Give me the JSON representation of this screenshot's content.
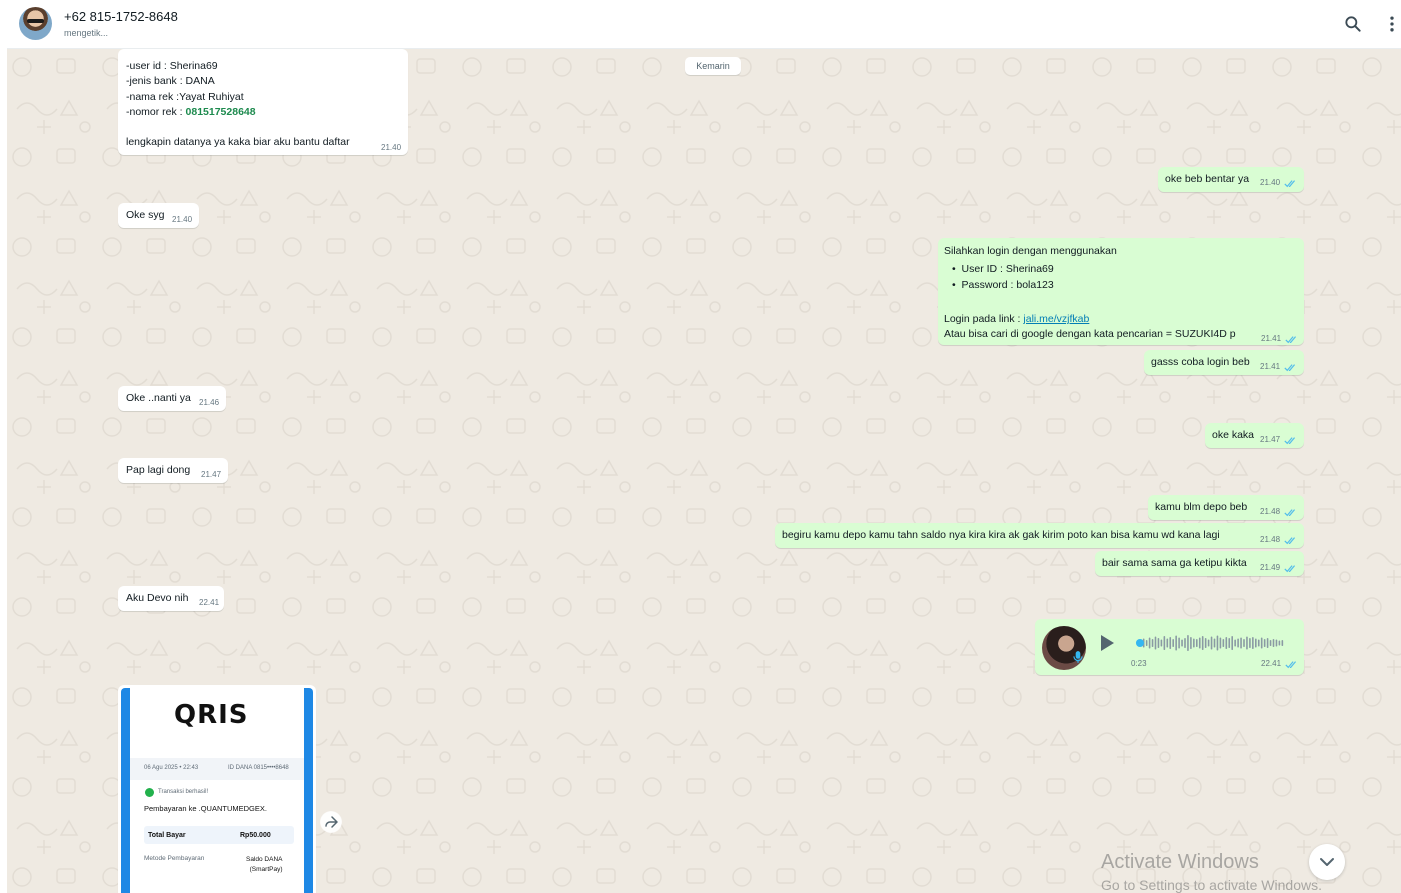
{
  "header": {
    "contact_name": "+62 815-1752-8648",
    "contact_status": "mengetik..."
  },
  "day_chip": "Kemarin",
  "messages": {
    "m1": {
      "lines": [
        "-user id : Sherina69",
        "-jenis bank : DANA",
        "-nama rek :Yayat Ruhiyat",
        "-nomor rek : ",
        "lengkapin datanya ya kaka biar aku bantu daftar"
      ],
      "account_number": "081517528648",
      "time": "21.40"
    },
    "m2": {
      "text": "oke beb bentar ya",
      "time": "21.40"
    },
    "m3": {
      "text": "Oke syg",
      "time": "21.40"
    },
    "m4": {
      "line1": "Silahkan login dengan menggunakan",
      "bullet1": "User ID : Sherina69",
      "bullet2": "Password : bola123",
      "login_label": "Login pada link : ",
      "link": "jali.me/vzjfkab",
      "line_last": "Atau bisa cari di google dengan kata pencarian = SUZUKI4D p",
      "time": "21.41"
    },
    "m5": {
      "text": "gasss coba login beb",
      "time": "21.41"
    },
    "m6": {
      "text": "Oke ..nanti ya",
      "time": "21.46"
    },
    "m7": {
      "text": "oke kaka",
      "time": "21.47"
    },
    "m8": {
      "text": "Pap lagi dong",
      "time": "21.47"
    },
    "m9": {
      "text": "kamu blm depo beb",
      "time": "21.48"
    },
    "m10": {
      "text": "begiru kamu depo kamu tahn saldo nya kira kira ak gak kirim poto kan bisa kamu wd kana lagi",
      "time": "21.48"
    },
    "m11": {
      "text": "bair sama sama ga ketipu kikta",
      "time": "21.49"
    },
    "m12": {
      "text": "Aku Devo nih",
      "time": "22.41"
    }
  },
  "voice_note": {
    "duration": "0:23",
    "time": "22.41",
    "progress": 0.02
  },
  "receipt": {
    "logo_text": "QRIS",
    "date": "06 Agu 2025 • 22:43",
    "id": "ID DANA 0815••••8648",
    "status": "Transaksi berhasil!",
    "payee": "Pembayaran ke .QUANTUMEDGEX.",
    "total_label": "Total Bayar",
    "total_value": "Rp50.000",
    "method_label": "Metode Pembayaran",
    "method_value_1": "Saldo DANA",
    "method_value_2": "(SmartPay)"
  },
  "watermark": {
    "line1": "Activate Windows",
    "line2": "Go to Settings to activate Windows."
  },
  "colors": {
    "incoming": "#ffffff",
    "outgoing": "#d9fdd3",
    "chat_bg": "#efeae2",
    "tick_read": "#53bdeb"
  },
  "icons": [
    "search-icon",
    "menu-icon",
    "double-check-icon",
    "play-icon",
    "mic-icon",
    "forward-icon",
    "chevron-down-icon"
  ]
}
